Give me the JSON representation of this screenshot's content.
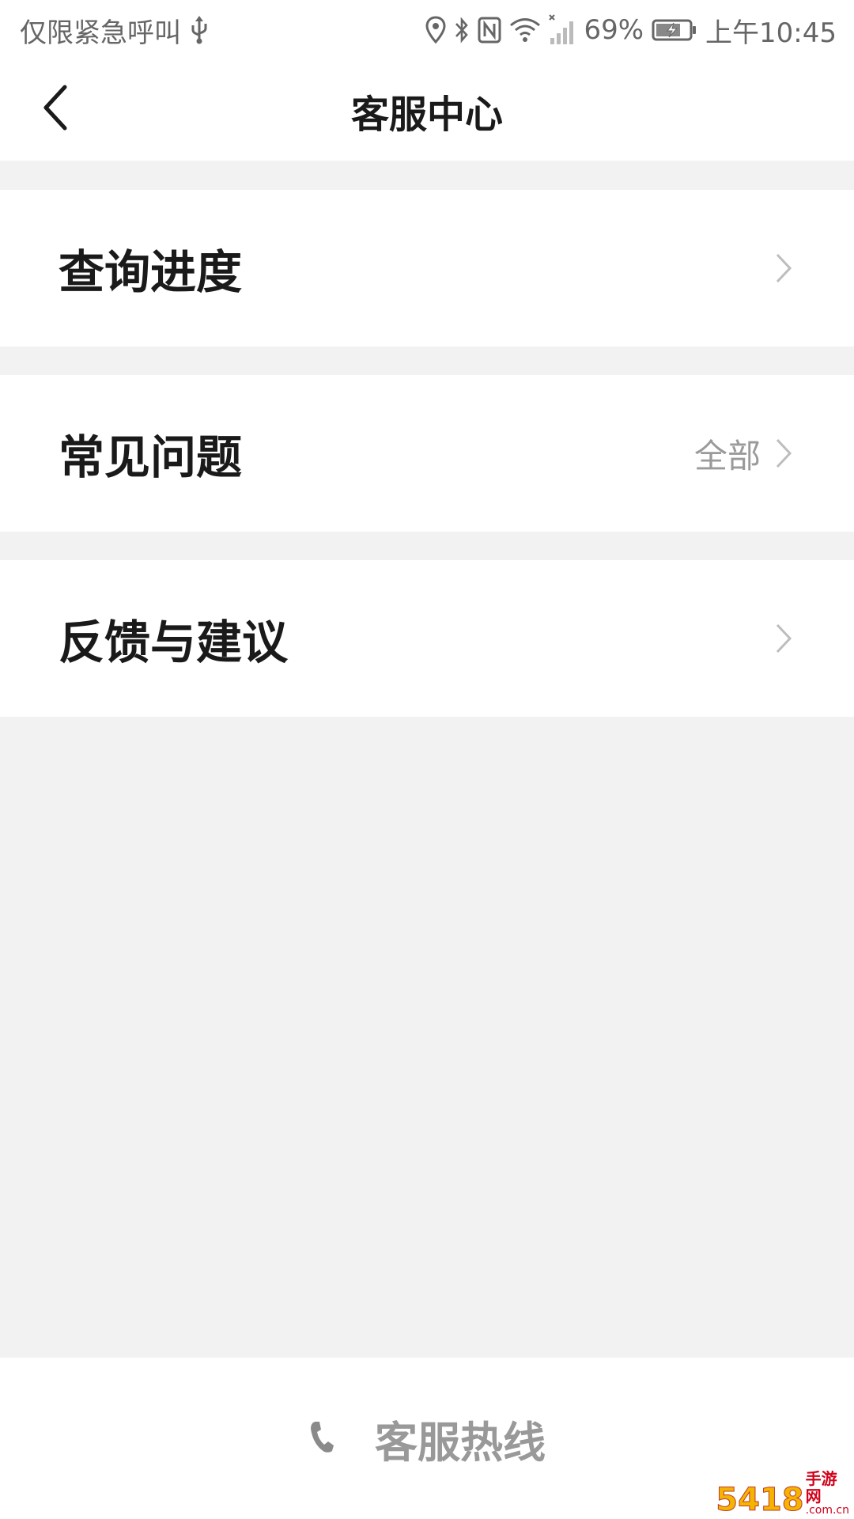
{
  "status_bar": {
    "carrier_text": "仅限紧急呼叫",
    "battery_percent": "69%",
    "time": "上午10:45",
    "icons": [
      "usb-icon",
      "location-icon",
      "bluetooth-icon",
      "nfc-icon",
      "wifi-icon",
      "signal-icon",
      "battery-charging-icon"
    ]
  },
  "nav": {
    "title": "客服中心",
    "back_icon": "back-arrow-icon"
  },
  "menu": {
    "items": [
      {
        "label": "查询进度",
        "extra": ""
      },
      {
        "label": "常见问题",
        "extra": "全部"
      },
      {
        "label": "反馈与建议",
        "extra": ""
      }
    ]
  },
  "hotline": {
    "label": "客服热线",
    "icon": "phone-icon"
  },
  "watermark": {
    "main": "5418",
    "top": "手游网",
    "bottom": ".com.cn"
  },
  "colors": {
    "page_background": "#f2f2f2",
    "card_background": "#ffffff",
    "title_text": "#1a1a1a",
    "secondary_text": "#9a9a9a",
    "chevron": "#bdbdbd"
  }
}
